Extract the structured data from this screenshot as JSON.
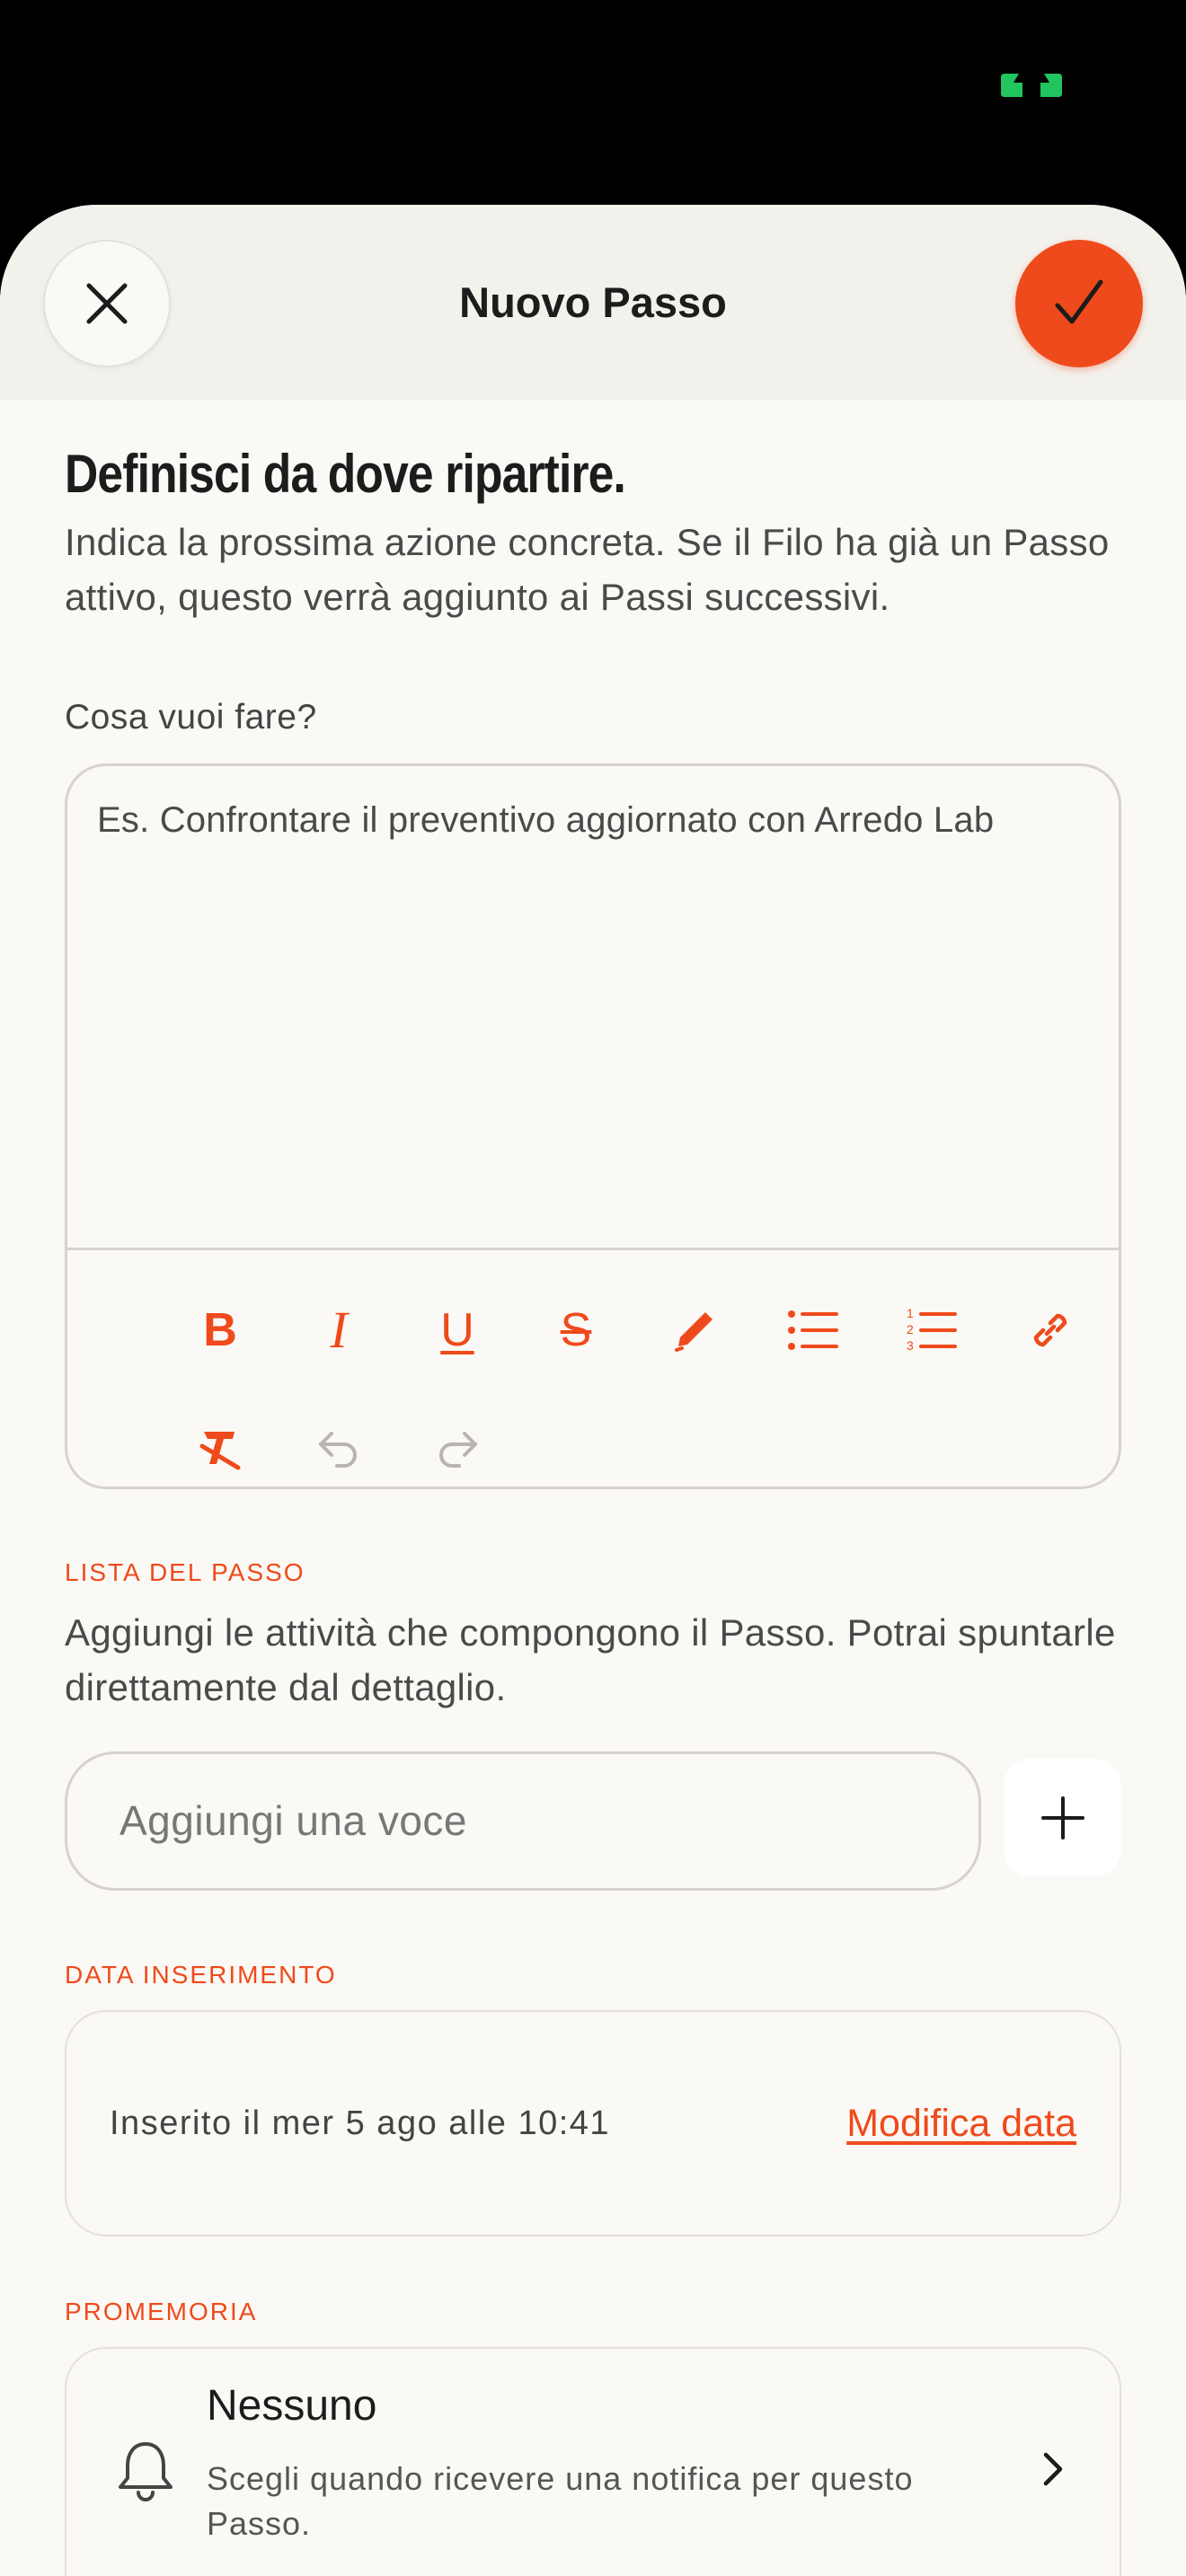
{
  "colors": {
    "accent": "#ef4a1b",
    "background": "#fbf9f5",
    "header_background": "#f3f1ec",
    "status_indicator": "#22c55e"
  },
  "header": {
    "title": "Nuovo Passo",
    "close_icon": "close-icon",
    "confirm_icon": "checkmark-icon"
  },
  "intro": {
    "heading": "Definisci da dove ripartire.",
    "description": "Indica la prossima azione concreta. Se il Filo ha già un Passo attivo, questo verrà aggiunto ai Passi successivi."
  },
  "editor": {
    "label": "Cosa vuoi fare?",
    "placeholder": "Es. Confrontare il preventivo aggiornato con Arredo Lab",
    "toolbar": {
      "bold": "B",
      "italic": "I",
      "underline": "U",
      "strikethrough": "S",
      "icons": [
        "bold-icon",
        "italic-icon",
        "underline-icon",
        "strikethrough-icon",
        "highlight-pen-icon",
        "bullet-list-icon",
        "numbered-list-icon",
        "link-icon",
        "clear-format-icon",
        "undo-icon",
        "redo-icon"
      ]
    }
  },
  "checklist": {
    "caption": "LISTA DEL PASSO",
    "description": "Aggiungi le attività che compongono il Passo. Potrai spuntarle direttamente dal dettaglio.",
    "input_placeholder": "Aggiungi una voce",
    "add_icon": "plus-icon"
  },
  "date": {
    "caption": "DATA INSERIMENTO",
    "text": "Inserito il mer 5 ago alle 10:41",
    "edit_link": "Modifica data"
  },
  "reminder": {
    "caption": "PROMEMORIA",
    "title": "Nessuno",
    "description": "Scegli quando ricevere una notifica per questo Passo.",
    "icon": "bell-icon"
  }
}
